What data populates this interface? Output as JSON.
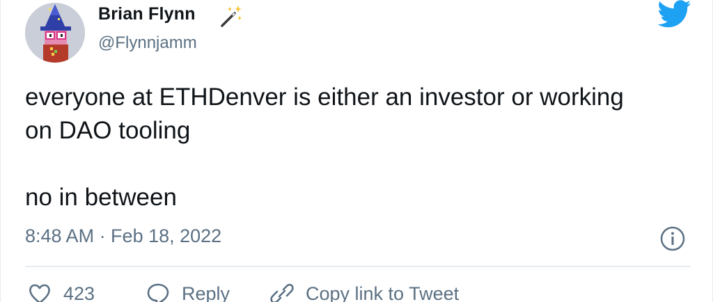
{
  "author": {
    "display_name": "Brian Flynn",
    "handle": "@Flynnjamm",
    "name_emoji": "magic-wand-emoji"
  },
  "tweet": {
    "line1": "everyone at ETHDenver is either an investor or working\non DAO tooling",
    "line2": "no in between",
    "timestamp": "8:48 AM · Feb 18, 2022"
  },
  "actions": {
    "like_count": "423",
    "reply_label": "Reply",
    "copy_label": "Copy link to Tweet"
  },
  "icons": {
    "brand": "twitter-bird-icon",
    "info": "info-icon",
    "like": "heart-icon",
    "reply": "speech-bubble-icon",
    "copy": "link-icon"
  },
  "colors": {
    "twitter_blue": "#1da1f2",
    "secondary_text": "#5b7083",
    "primary_text": "#0f1419",
    "divider": "#e6ecf0"
  }
}
